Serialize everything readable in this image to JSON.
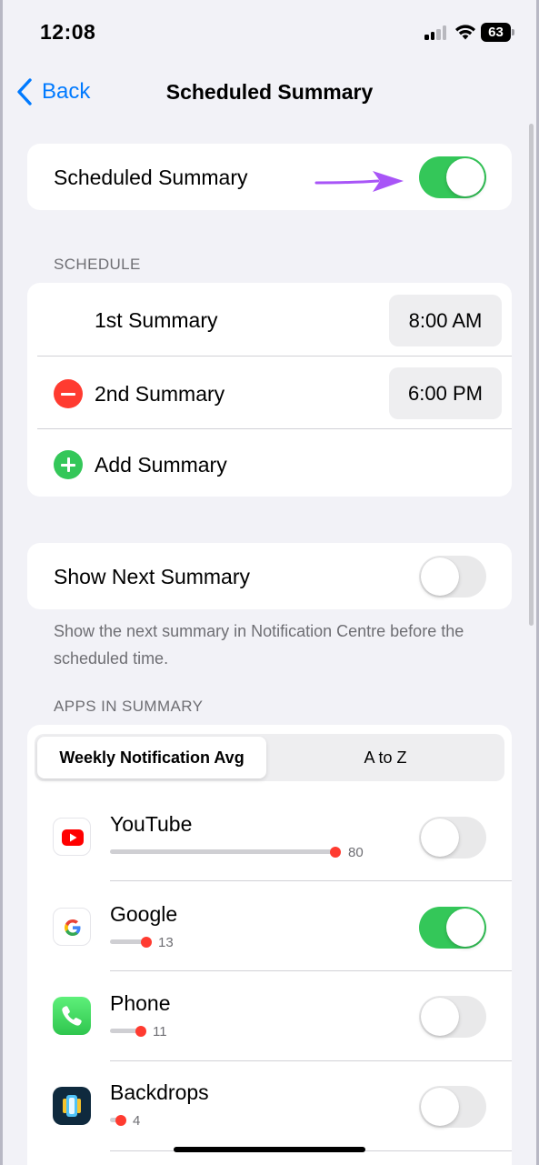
{
  "status_bar": {
    "time": "12:08",
    "battery_level": "63"
  },
  "nav": {
    "back_label": "Back",
    "title": "Scheduled Summary"
  },
  "scheduled_summary": {
    "label": "Scheduled Summary",
    "enabled": true,
    "arrow_color": "#a855f7"
  },
  "schedule": {
    "header": "SCHEDULE",
    "items": [
      {
        "label": "1st Summary",
        "time": "8:00 AM"
      },
      {
        "label": "2nd Summary",
        "time": "6:00 PM"
      }
    ],
    "add_label": "Add Summary"
  },
  "show_next": {
    "label": "Show Next Summary",
    "enabled": false,
    "footnote": "Show the next summary in Notification Centre before the scheduled time."
  },
  "apps": {
    "header": "APPS IN SUMMARY",
    "sort_options": [
      "Weekly Notification Avg",
      "A to Z"
    ],
    "selected_sort": "Weekly Notification Avg",
    "items": [
      {
        "name": "YouTube",
        "count": "80",
        "enabled": false,
        "icon": "youtube-icon"
      },
      {
        "name": "Google",
        "count": "13",
        "enabled": true,
        "icon": "google-icon"
      },
      {
        "name": "Phone",
        "count": "11",
        "enabled": false,
        "icon": "phone-icon"
      },
      {
        "name": "Backdrops",
        "count": "4",
        "enabled": false,
        "icon": "backdrops-icon"
      }
    ]
  },
  "colors": {
    "accent": "#007aff",
    "toggle_on": "#34c759",
    "destructive": "#ff3b30"
  }
}
